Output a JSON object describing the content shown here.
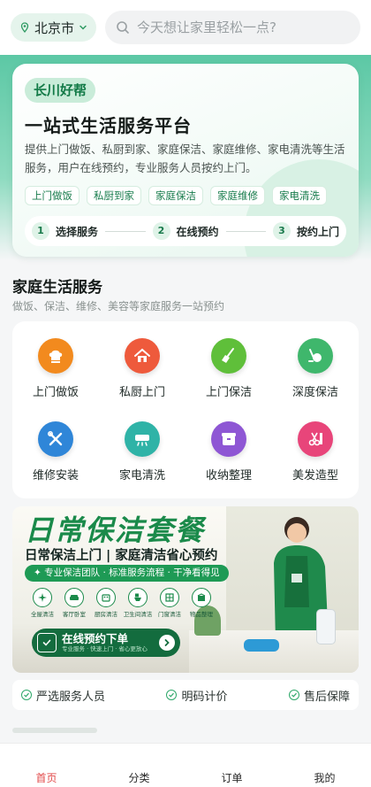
{
  "header": {
    "city": "北京市",
    "search_placeholder": "今天想让家里轻松一点?"
  },
  "hero": {
    "brand": "长川好帮",
    "title": "一站式生活服务平台",
    "description": "提供上门做饭、私厨到家、家庭保洁、家庭维修、家电清洗等生活服务，用户在线预约，专业服务人员按约上门。",
    "tags": [
      "上门做饭",
      "私厨到家",
      "家庭保洁",
      "家庭维修",
      "家电清洗"
    ],
    "steps": [
      {
        "num": "1",
        "label": "选择服务"
      },
      {
        "num": "2",
        "label": "在线预约"
      },
      {
        "num": "3",
        "label": "按约上门"
      }
    ]
  },
  "section": {
    "title": "家庭生活服务",
    "subtitle": "做饭、保洁、维修、美容等家庭服务一站预约"
  },
  "services": [
    {
      "label": "上门做饭",
      "icon": "chef-hat-icon",
      "color": "#f28a1e"
    },
    {
      "label": "私厨上门",
      "icon": "home-chef-icon",
      "color": "#ee5a3c"
    },
    {
      "label": "上门保洁",
      "icon": "broom-icon",
      "color": "#5fbf3a"
    },
    {
      "label": "深度保洁",
      "icon": "vacuum-icon",
      "color": "#3fb76c"
    },
    {
      "label": "维修安装",
      "icon": "wrench-screwdriver-icon",
      "color": "#2f86d8"
    },
    {
      "label": "家电清洗",
      "icon": "air-conditioner-icon",
      "color": "#2fb3a7"
    },
    {
      "label": "收纳整理",
      "icon": "storage-box-icon",
      "color": "#8e56d4"
    },
    {
      "label": "美发造型",
      "icon": "scissors-comb-icon",
      "color": "#e8457a"
    }
  ],
  "banner": {
    "title": "日常保洁套餐",
    "subtitle": "日常保洁上门 | 家庭清洁省心预约",
    "tagline": "✦ 专业保洁团队 · 标准服务流程 · 干净看得见",
    "features": [
      {
        "label": "全屋清洁",
        "icon": "sparkle-icon"
      },
      {
        "label": "客厅卧室",
        "icon": "sofa-icon"
      },
      {
        "label": "厨房清洁",
        "icon": "stove-icon"
      },
      {
        "label": "卫生间清洁",
        "icon": "toilet-icon"
      },
      {
        "label": "门窗清洁",
        "icon": "window-icon"
      },
      {
        "label": "物品整理",
        "icon": "box-icon"
      }
    ],
    "cta_main": "在线预约下单",
    "cta_sub": "专业服务 · 快速上门 · 省心更放心",
    "badge": "长川好帮"
  },
  "guarantees": [
    "严选服务人员",
    "明码计价",
    "售后保障"
  ],
  "tabs": [
    {
      "label": "首页",
      "active": true
    },
    {
      "label": "分类",
      "active": false
    },
    {
      "label": "订单",
      "active": false
    },
    {
      "label": "我的",
      "active": false
    }
  ],
  "colors": {
    "brand_green": "#1a8a4a",
    "accent_red": "#e24a4a",
    "hero_gradient_top": "#5cc8a5"
  }
}
